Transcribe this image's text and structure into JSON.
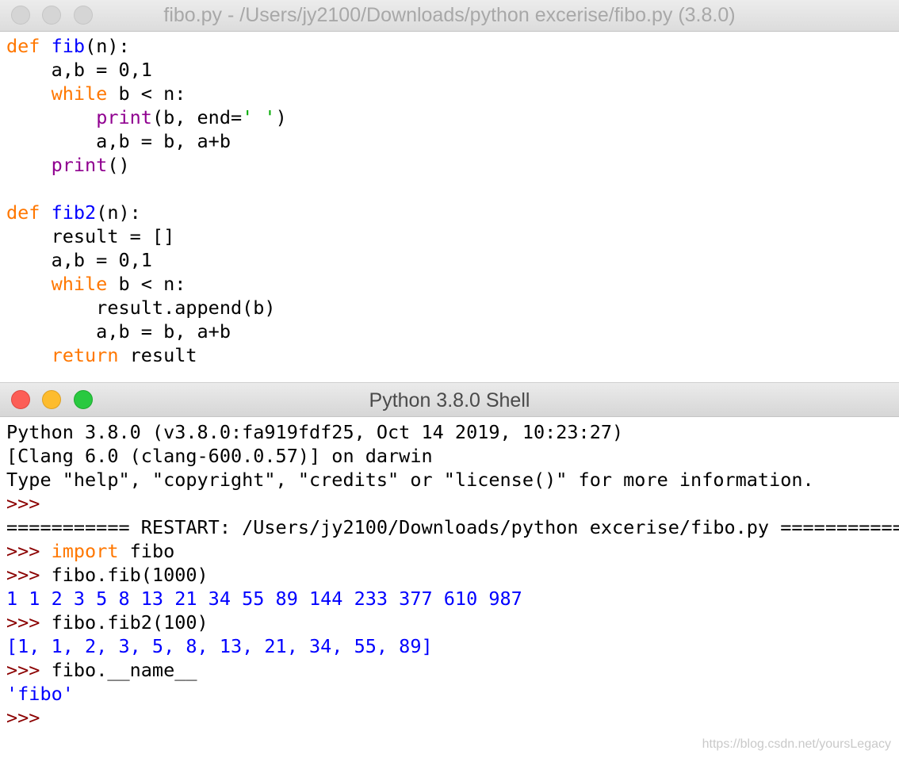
{
  "editor": {
    "title": "fibo.py - /Users/jy2100/Downloads/python excerise/fibo.py (3.8.0)",
    "tokens": {
      "l1": [
        "def",
        " ",
        "fib",
        "(n):"
      ],
      "l2": [
        "    a,b = 0,1"
      ],
      "l3": [
        "    ",
        "while",
        " b < n:"
      ],
      "l4": [
        "        ",
        "print",
        "(b, end=",
        "' '",
        ")"
      ],
      "l5": [
        "        a,b = b, a+b"
      ],
      "l6": [
        "    ",
        "print",
        "()"
      ],
      "l7": [
        ""
      ],
      "l8": [
        "def",
        " ",
        "fib2",
        "(n):"
      ],
      "l9": [
        "    result = []"
      ],
      "l10": [
        "    a,b = 0,1"
      ],
      "l11": [
        "    ",
        "while",
        " b < n:"
      ],
      "l12": [
        "        result.append(b)"
      ],
      "l13": [
        "        a,b = b, a+b"
      ],
      "l14": [
        "    ",
        "return",
        " result"
      ]
    }
  },
  "shell": {
    "title": "Python 3.8.0 Shell",
    "banner1": "Python 3.8.0 (v3.8.0:fa919fdf25, Oct 14 2019, 10:23:27)",
    "banner2": "[Clang 6.0 (clang-600.0.57)] on darwin",
    "banner3": "Type \"help\", \"copyright\", \"credits\" or \"license()\" for more information.",
    "prompt": ">>>",
    "restart": "=========== RESTART: /Users/jy2100/Downloads/python excerise/fibo.py ===========",
    "import_kw": "import",
    "import_rest": " fibo",
    "cmd_fib": " fibo.fib(1000)",
    "out_fib": "1 1 2 3 5 8 13 21 34 55 89 144 233 377 610 987",
    "cmd_fib2": " fibo.fib2(100)",
    "out_fib2": "[1, 1, 2, 3, 5, 8, 13, 21, 34, 55, 89]",
    "cmd_name": " fibo.__name__",
    "out_name": "'fibo'"
  },
  "watermark": "https://blog.csdn.net/yoursLegacy",
  "colors": {
    "keyword": "#ff7700",
    "definition": "#0000ff",
    "builtin": "#900090",
    "string": "#00aa00",
    "output": "#0000ff",
    "prompt": "#8b0000"
  }
}
